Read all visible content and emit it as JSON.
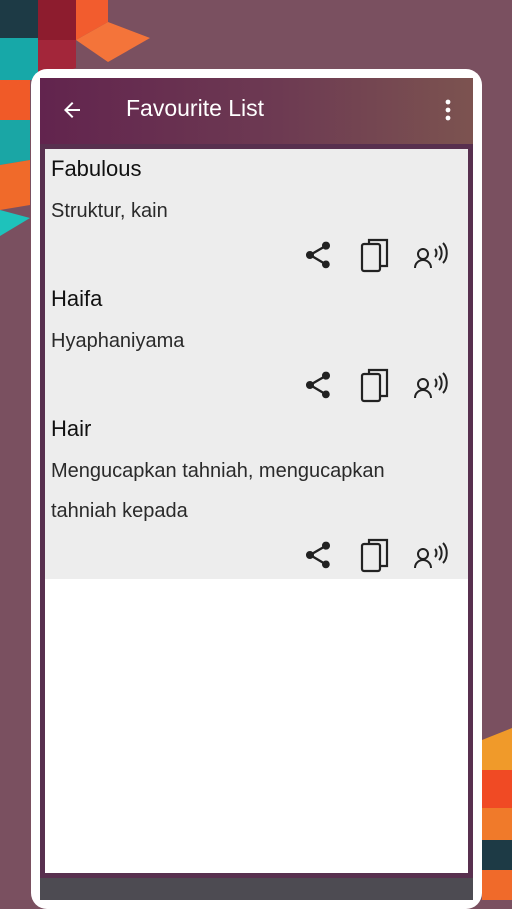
{
  "app_bar": {
    "title": "Favourite List",
    "back_icon": "arrow-left-icon",
    "menu_icon": "more-vertical-icon"
  },
  "favourites": [
    {
      "word": "Fabulous",
      "meaning": "Struktur, kain"
    },
    {
      "word": "Haifa",
      "meaning": "Hyaphaniyama"
    },
    {
      "word": "Hair",
      "meaning": "Mengucapkan tahniah, mengucapkan tahniah kepada"
    }
  ],
  "item_actions": [
    "share-icon",
    "copy-icon",
    "speak-icon"
  ],
  "colors": {
    "background": "#7a5060",
    "app_bar_start": "#62244e",
    "app_bar_end": "#7c5350",
    "list_background": "#ededed",
    "accent_orange": "#f06a2a",
    "accent_teal": "#1fb5b0"
  }
}
